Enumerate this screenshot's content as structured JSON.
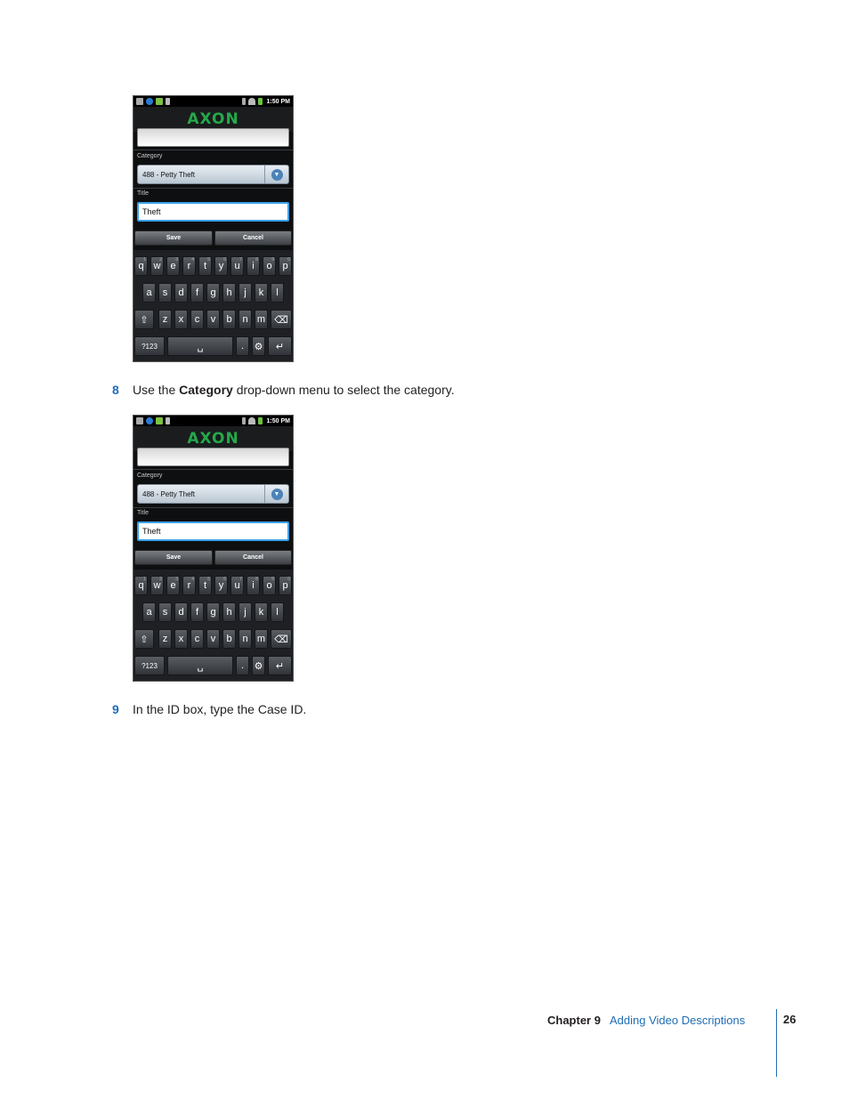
{
  "screenshots": [
    {
      "status_time": "1:50 PM",
      "logo_text": "AXON",
      "category_label": "Category",
      "category_value": "488 - Petty Theft",
      "title_label": "Title",
      "title_value": "Theft",
      "save_label": "Save",
      "cancel_label": "Cancel"
    },
    {
      "status_time": "1:50 PM",
      "logo_text": "AXON",
      "category_label": "Category",
      "category_value": "488 - Petty Theft",
      "title_label": "Title",
      "title_value": "Theft",
      "save_label": "Save",
      "cancel_label": "Cancel"
    }
  ],
  "keyboard": {
    "row1": [
      "q",
      "w",
      "e",
      "r",
      "t",
      "y",
      "u",
      "i",
      "o",
      "p"
    ],
    "row1_nums": [
      "1",
      "2",
      "3",
      "4",
      "5",
      "6",
      "7",
      "8",
      "9",
      "0"
    ],
    "row2": [
      "a",
      "s",
      "d",
      "f",
      "g",
      "h",
      "j",
      "k",
      "l"
    ],
    "row3": [
      "z",
      "x",
      "c",
      "v",
      "b",
      "n",
      "m"
    ],
    "shift": "⇧",
    "delete": "⌫",
    "sym": "?123",
    "space": "␣",
    "period": ".",
    "settings": "⚙",
    "enter": "↵"
  },
  "steps": [
    {
      "number": "8",
      "text_before": "Use the ",
      "bold": "Category",
      "text_after": " drop-down menu to select the category."
    },
    {
      "number": "9",
      "text": "In the ID box, type the Case ID."
    }
  ],
  "footer": {
    "chapter": "Chapter 9",
    "title": "Adding Video Descriptions",
    "page": "26"
  },
  "colors": {
    "accent_blue": "#1f6db4",
    "logo_green": "#25a84a",
    "focus_blue": "#3aa1e8"
  }
}
